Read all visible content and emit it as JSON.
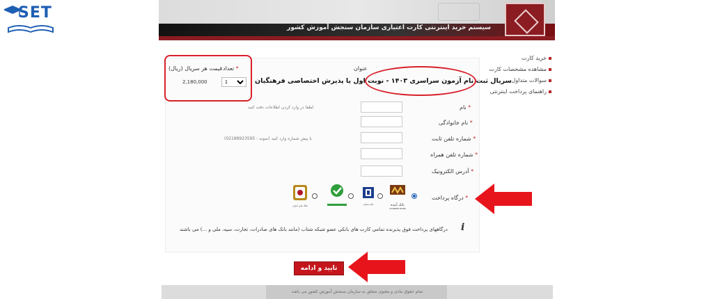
{
  "logo": {
    "text": "SET"
  },
  "banner": {
    "title": "سیستم خرید اینترنتی کارت اعتباری سازمان سنجش آموزش کشور"
  },
  "menu": {
    "items": [
      "خرید کارت",
      "مشاهده مشخصات کارت",
      "سوالات متداول",
      "راهنمای پرداخت اینترنتی"
    ]
  },
  "table": {
    "header_title": "عنوان",
    "header_count": "تعداد",
    "header_price": "قیمت هر سریال (ریال)",
    "item_title": "سریال ثبت نام آزمون سراسری ۱۴۰۳ - نوبت اول یا پذیرش اختصاصی فرهنگیان",
    "quantity": "1",
    "price": "2,180,000"
  },
  "form": {
    "first_name_label": "نام",
    "first_name_hint": "لطفا در وارد کردن اطلاعات دقت کنید",
    "last_name_label": "نام خانوادگی",
    "phone_label": "شماره تلفن ثابت",
    "phone_hint": "با پیش شماره وارد کنید (نمونه : 02188923595)",
    "mobile_label": "شماره تلفن همراه",
    "email_label": "آدرس الکترونیک",
    "gateway_label": "درگاه پرداخت",
    "note": "درگاههای پرداخت فوق پذیرنده تمامی کارت های بانکی عضو شبکه شتاب (مانند بانک های صادرات، تجارت، سپه، ملی و ...) می باشند"
  },
  "banks": {
    "ayandeh_name": "بانک آینده",
    "ayandeh_latin": "AYANDEH BANK",
    "saman_name": "بانک سامان",
    "melli_name": "بانک ملی ایران"
  },
  "actions": {
    "confirm_label": "تایید و ادامه"
  },
  "footer": {
    "text": "تمام حقوق مادی و معنوی متعلق به سازمان سنجش آموزش کشور می باشد"
  },
  "colors": {
    "accent": "#c4161c",
    "annotation": "#d8202a",
    "brand": "#1e5fb4"
  }
}
